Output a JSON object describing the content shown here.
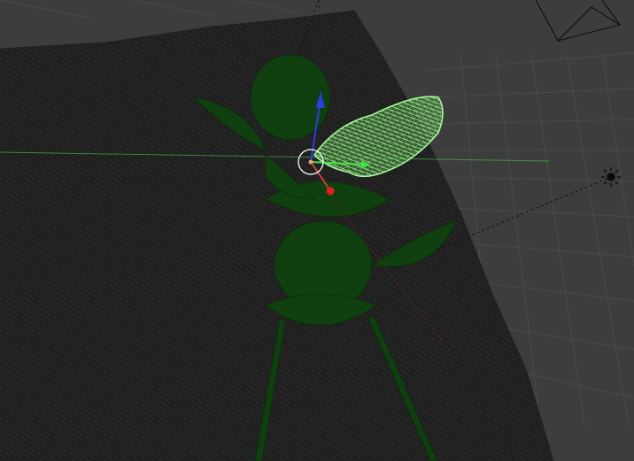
{
  "viewport": {
    "mode": "3d-wireframe",
    "background_color": "#3d3d3d",
    "grid_color": "#4a4a4a",
    "ground_mesh_color": "#1e1e1e",
    "ground_wire_color": "#2c2c2c",
    "plant_mesh_color": "#0c3a0c",
    "plant_wire_color": "#1a4f1a",
    "selected_leaf_color": "#86e07a",
    "x_axis_color": "#d43c3c",
    "y_axis_color": "#47b247",
    "z_axis_color": "#2a3ee0"
  },
  "objects": {
    "ground": {
      "icon": "wireframe-plane"
    },
    "plant": {
      "icon": "wireframe-plant-mesh"
    },
    "selected_leaf": {
      "icon": "selected-leaf-mesh"
    },
    "camera": {
      "icon": "camera-frustum-icon"
    },
    "light": {
      "icon": "sun-light-icon"
    }
  },
  "gizmo": {
    "icon": "transform-gizmo",
    "axes": [
      "x",
      "y",
      "z"
    ]
  }
}
